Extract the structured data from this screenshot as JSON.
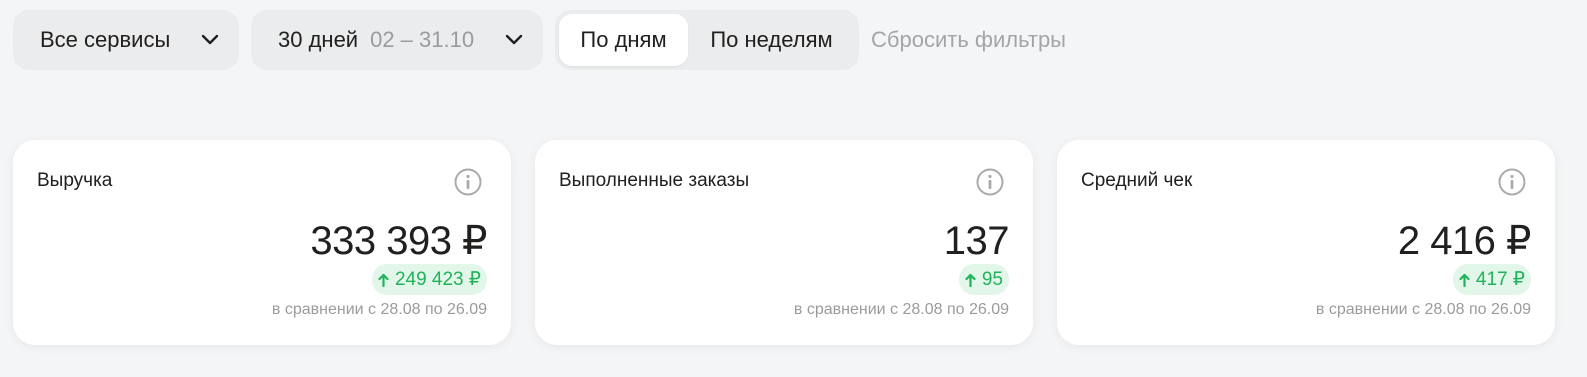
{
  "filters": {
    "services_label": "Все сервисы",
    "period_label": "30 дней",
    "period_range": "02 – 31.10",
    "view_days": "По дням",
    "view_weeks": "По неделям",
    "reset_label": "Сбросить фильтры",
    "active_view": "По дням"
  },
  "cards": [
    {
      "title": "Выручка",
      "value": "333 393 ₽",
      "delta": "249 423 ₽",
      "delta_direction": "up",
      "compare": "в сравнении с 28.08 по 26.09",
      "info_icon": "info-circle-icon"
    },
    {
      "title": "Выполненные заказы",
      "value": "137",
      "delta": "95",
      "delta_direction": "up",
      "compare": "в сравнении с 28.08 по 26.09",
      "info_icon": "info-circle-icon"
    },
    {
      "title": "Средний чек",
      "value": "2 416 ₽",
      "delta": "417 ₽",
      "delta_direction": "up",
      "compare": "в сравнении с 28.08 по 26.09",
      "info_icon": "info-circle-icon"
    }
  ],
  "colors": {
    "background": "#f4f5f6",
    "control_bg": "#ebeced",
    "card_bg": "#ffffff",
    "text_primary": "#21201f",
    "text_muted": "#9a9b9c",
    "positive": "#1fb35a",
    "positive_bg": "#e3f6ea"
  }
}
